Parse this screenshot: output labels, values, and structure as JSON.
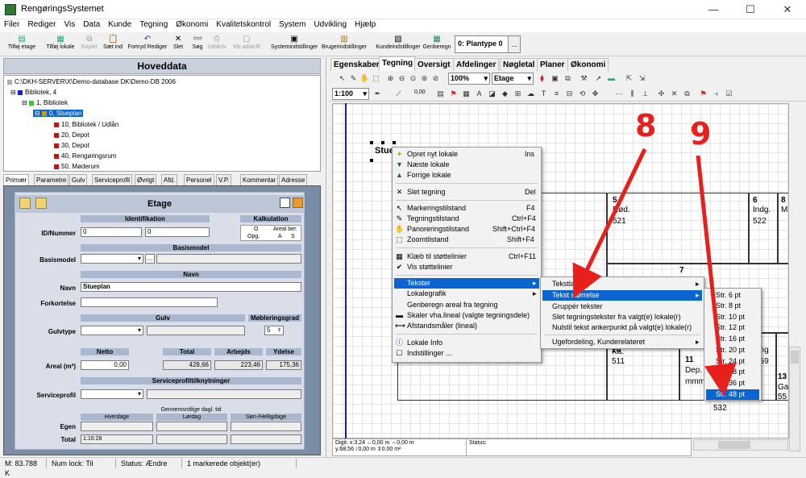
{
  "window": {
    "title": "RengøringsSystemet",
    "minimize": "—",
    "maximize": "☐",
    "close": "✕"
  },
  "menubar": [
    "Filer",
    "Rediger",
    "Vis",
    "Data",
    "Kunde",
    "Tegning",
    "Økonomi",
    "Kvalitetskontrol",
    "System",
    "Udvikling",
    "Hjælp"
  ],
  "toolbar": {
    "buttons": [
      {
        "label": "Tilføj etage",
        "icon": "add-floor-icon",
        "enabled": true
      },
      {
        "label": "Tilføj lokale",
        "icon": "add-room-icon",
        "enabled": true
      },
      {
        "label": "Kopier",
        "icon": "copy-icon",
        "enabled": false
      },
      {
        "label": "Sæt ind",
        "icon": "paste-icon",
        "enabled": true
      },
      {
        "label": "Fortryd Rediger",
        "icon": "undo-icon",
        "enabled": true
      },
      {
        "label": "Slet",
        "icon": "delete-icon",
        "enabled": true
      },
      {
        "label": "Søg",
        "icon": "binoculars-icon",
        "enabled": true
      },
      {
        "label": "Udskriv",
        "icon": "print-icon",
        "enabled": false
      },
      {
        "label": "Vis udskrift",
        "icon": "preview-icon",
        "enabled": false
      },
      {
        "label": "Systemindstillinger",
        "icon": "system-settings-icon",
        "enabled": true
      },
      {
        "label": "Brugerindstillinger",
        "icon": "user-settings-icon",
        "enabled": true
      },
      {
        "label": "Kundeindstillinger",
        "icon": "customer-settings-icon",
        "enabled": true
      },
      {
        "label": "Genberegn",
        "icon": "calculator-icon",
        "enabled": true
      }
    ],
    "plantype": "0: Plantype 0",
    "plantype_btn": "..."
  },
  "left": {
    "title": "Hoveddata",
    "tree": [
      {
        "text": "C:\\DKH-SERVER\\X\\Demo-database DK\\Demo-DB 2006",
        "level": 0
      },
      {
        "text": "Bibliotek, 4",
        "level": 1
      },
      {
        "text": "1, Bibliotek",
        "level": 2
      },
      {
        "text": "0, Stueplan",
        "level": 3,
        "selected": true
      },
      {
        "text": "10, Bibliotek / Udlån",
        "level": 4
      },
      {
        "text": "20, Depot",
        "level": 4
      },
      {
        "text": "30, Depot",
        "level": 4
      },
      {
        "text": "40, Rengøringsrum",
        "level": 4
      },
      {
        "text": "50, Møderum",
        "level": 4
      }
    ],
    "tabs": [
      "Primær",
      "Parametre",
      "Gulv",
      "Serviceprofil",
      "Øvrigt",
      "Afd.",
      "Personel",
      "V.P.",
      "Kommentar",
      "Adresse"
    ],
    "form": {
      "title": "Etage",
      "identifikation": "Identifikation",
      "kalkulation": "Kalkulation",
      "kalk_o": "O",
      "kalk_areal": "Areal ber.",
      "kalk_opg": "Opg.",
      "kalk_a": "A",
      "kalk_s": "S",
      "id_label": "ID/Nummer",
      "id_value": "0",
      "nummer_value": "0",
      "basismodel_head": "Basismodel",
      "basismodel_label": "Basismodel",
      "basismodel_btn": "...",
      "navn_head": "Navn",
      "navn_label": "Navn",
      "navn_value": "Stueplan",
      "forkortelse_label": "Forkortelse",
      "gulv_head": "Gulv",
      "mobl_head": "Møbleringsgrad",
      "gulvtype_label": "Gulvtype",
      "mobl_value": "5",
      "netto_head": "Netto",
      "total_head": "Total",
      "arbejds_head": "Arbejds",
      "ydelse_head": "Ydelse",
      "areal_label": "Areal (m²)",
      "netto_value": "0,00",
      "total_value": "428,66",
      "arbejds_value": "223,46",
      "ydelse_value": "175,36",
      "service_head": "Serviceprofiltilknytninger",
      "service_label": "Serviceprofil",
      "tid_head": "Gennemsnitlige dagl. tid",
      "hverdage": "Hverdage",
      "lordag": "Lørdag",
      "sondag": "Søn-/Helligdage",
      "egen_label": "Egen",
      "total_label": "Total",
      "total_hverdage": "1:16:28"
    }
  },
  "right": {
    "tabs": [
      "Egenskaber",
      "Tegning",
      "Oversigt",
      "Afdelinger",
      "Nøgletal",
      "Planer",
      "Økonomi"
    ],
    "active_tab": "Tegning",
    "zoom": "100%",
    "level": "Etage",
    "scale": "1:100",
    "line_value": "0,00",
    "drawing": {
      "label": "Stue",
      "rooms": [
        {
          "num": "5",
          "name": "Rød.",
          "code": "521"
        },
        {
          "num": "6",
          "name": "Indg.",
          "code": "522"
        },
        {
          "num": "8",
          "name": "M",
          "code": ""
        },
        {
          "num": "7",
          "name": "",
          "code": ""
        },
        {
          "num": "10",
          "name": "Ka.",
          "code": "511"
        },
        {
          "num": "11",
          "name": "Dep.",
          "code": "mmm"
        },
        {
          "num": "13",
          "name": "Ga",
          "code": "55"
        },
        {
          "num": "",
          "name": "ang",
          "code": "559"
        },
        {
          "num": "",
          "name": "",
          "code": "532"
        }
      ]
    },
    "coords": {
      "x_label": "Digit. x:",
      "x": "3,24",
      "y_label": "y:",
      "y": "68,56",
      "mx": "0,00 m",
      "my": "0,00 m",
      "dx": "0,00 m",
      "dy": "0,00 m²"
    },
    "status_label": "Status:"
  },
  "context_menu": {
    "items": [
      {
        "label": "Opret nyt lokale",
        "shortcut": "Ins",
        "icon": "new-room-icon"
      },
      {
        "label": "Næste lokale",
        "shortcut": "",
        "icon": "arrow-down-icon"
      },
      {
        "label": "Forrige lokale",
        "shortcut": "",
        "icon": "arrow-up-icon"
      },
      {
        "label": "Slet tegning",
        "shortcut": "Del",
        "icon": "close-icon"
      },
      {
        "label": "Markeringstilstand",
        "shortcut": "F4",
        "icon": "cursor-icon"
      },
      {
        "label": "Tegningstilstand",
        "shortcut": "Ctrl+F4",
        "icon": "draw-icon"
      },
      {
        "label": "Panoreringstilstand",
        "shortcut": "Shift+Ctrl+F4",
        "icon": "hand-icon"
      },
      {
        "label": "Zoomtilstand",
        "shortcut": "Shift+F4",
        "icon": "zoom-icon"
      },
      {
        "label": "Klæb til støttelinier",
        "shortcut": "Ctrl+F11",
        "icon": "snap-icon"
      },
      {
        "label": "Vis støttelinier",
        "shortcut": "",
        "icon": "check-icon"
      },
      {
        "label": "Tekster",
        "shortcut": "",
        "icon": ""
      },
      {
        "label": "Lokalegrafik",
        "shortcut": "",
        "icon": ""
      },
      {
        "label": "Genberegn areal fra tegning",
        "shortcut": "",
        "icon": ""
      },
      {
        "label": "Skaler vha.lineal (valgte tegningsdele)",
        "shortcut": "",
        "icon": "ruler-icon"
      },
      {
        "label": "Afstandsmåler (lineal)",
        "shortcut": "",
        "icon": "measure-icon"
      },
      {
        "label": "Lokale Info",
        "shortcut": "",
        "icon": "info-icon"
      },
      {
        "label": "Indstillinger ...",
        "shortcut": "",
        "icon": "settings-icon"
      }
    ]
  },
  "submenu_tekster": {
    "items": [
      "Tekstlayout",
      "Tekst størrelse",
      "Gruppér tekster",
      "Slet tegningstekster fra valgt(e) lokale(r)",
      "Nulstil tekst ankerpunkt på valgt(e) lokale(r)",
      "Ugefordeling, Kunderelateret"
    ]
  },
  "submenu_size": {
    "items": [
      "Str. 6 pt",
      "Str. 8 pt",
      "Str. 10 pt",
      "Str. 12 pt",
      "Str. 16 pt",
      "Str. 20 pt",
      "Str. 24 pt",
      "Str. 28 pt",
      "Str. 36 pt",
      "Str. 48 pt"
    ]
  },
  "annotations": {
    "step_a": "8",
    "step_b": "9",
    "arrow_color": "#e8201c"
  },
  "statusbar": [
    "M: 83.788 K",
    "Num lock: Til",
    "Status: Ændre",
    "1 markerede objekt(er)"
  ]
}
